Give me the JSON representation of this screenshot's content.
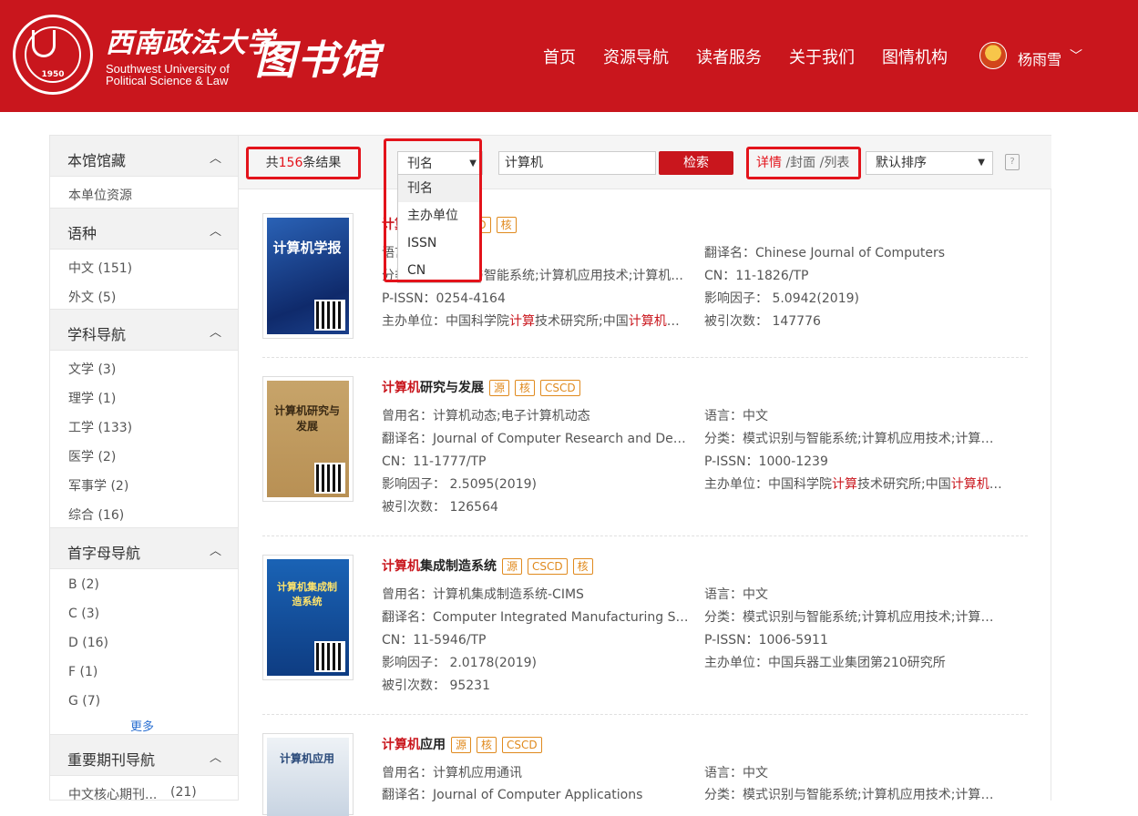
{
  "header": {
    "university_cn": "西南政法大学",
    "university_en_line1": "Southwest University of",
    "university_en_line2": "Political Science & Law",
    "seal_year": "1950",
    "library_title": "图书馆",
    "brand_color": "#c9161d",
    "nav": [
      "首页",
      "资源导航",
      "读者服务",
      "关于我们",
      "图情机构"
    ],
    "user_name": "杨雨雪",
    "user_caret": "﹀"
  },
  "sidebar": {
    "sections": [
      {
        "title": "本馆馆藏",
        "collapse_icon": "︿",
        "items": [
          "本单位资源"
        ]
      },
      {
        "title": "语种",
        "collapse_icon": "︿",
        "items": [
          "中文 (151)",
          "外文 (5)"
        ]
      },
      {
        "title": "学科导航",
        "collapse_icon": "︿",
        "items": [
          "文学 (3)",
          "理学 (1)",
          "工学 (133)",
          "医学 (2)",
          "军事学 (2)",
          "综合 (16)"
        ]
      },
      {
        "title": "首字母导航",
        "collapse_icon": "︿",
        "items": [
          "B (2)",
          "C (3)",
          "D (16)",
          "F (1)",
          "G (7)"
        ],
        "more": "更多"
      },
      {
        "title": "重要期刊导航",
        "collapse_icon": "︿",
        "items": [
          "中文核心期刊..."
        ],
        "counts": [
          "(21)"
        ]
      }
    ]
  },
  "toolbar": {
    "result_prefix": "共",
    "result_count": "156",
    "result_suffix": "条结果",
    "field_select_value": "刊名",
    "field_options": [
      "刊名",
      "主办单位",
      "ISSN",
      "CN"
    ],
    "search_value": "计算机",
    "search_button": "检索",
    "view_modes": {
      "active": "详情",
      "cover": " /封面",
      "list": " /列表"
    },
    "sort_value": "默认排序",
    "help_icon": "?"
  },
  "results": [
    {
      "title_hl": "计算机",
      "title_rest": "学报",
      "tags": [
        "CSCD",
        "核"
      ],
      "cover_title": "计算机学报",
      "left": [
        "语言：中文",
        "分类：模式识别与智能系统;计算机应用技术;计算机...",
        "P-ISSN：0254-4164",
        "主办单位：中国科学院计算技术研究所;中国计算机学会"
      ],
      "right": [
        "翻译名：Chinese Journal of Computers",
        "CN：11-1826/TP",
        "影响因子：  5.0942(2019)",
        "被引次数：  147776"
      ]
    },
    {
      "title_hl": "计算机",
      "title_rest": "研究与发展",
      "tags": [
        "源",
        "核",
        "CSCD"
      ],
      "cover_title": "计算机研究与发展",
      "left": [
        "曾用名：计算机动态;电子计算机动态",
        "翻译名：Journal of Computer Research and Deve...",
        "CN：11-1777/TP",
        "影响因子：  2.5095(2019)",
        "被引次数：  126564"
      ],
      "right": [
        "语言：中文",
        "分类：模式识别与智能系统;计算机应用技术;计算机...",
        "P-ISSN：1000-1239",
        "主办单位：中国科学院计算技术研究所;中国计算机学会"
      ]
    },
    {
      "title_hl": "计算机",
      "title_rest": "集成制造系统",
      "tags": [
        "源",
        "CSCD",
        "核"
      ],
      "cover_title": "计算机集成制造系统",
      "left": [
        "曾用名：计算机集成制造系统-CIMS",
        "翻译名：Computer Integrated Manufacturing Sys...",
        "CN：11-5946/TP",
        "影响因子：  2.0178(2019)",
        "被引次数：  95231"
      ],
      "right": [
        "语言：中文",
        "分类：模式识别与智能系统;计算机应用技术;计算机...",
        "P-ISSN：1006-5911",
        "主办单位：中国兵器工业集团第210研究所"
      ]
    },
    {
      "title_hl": "计算机",
      "title_rest": "应用",
      "tags": [
        "源",
        "核",
        "CSCD"
      ],
      "cover_title": "计算机应用",
      "left": [
        "曾用名：计算机应用通讯",
        "翻译名：Journal of Computer Applications"
      ],
      "right": [
        "语言：中文",
        "分类：模式识别与智能系统;计算机应用技术;计算机..."
      ]
    }
  ]
}
